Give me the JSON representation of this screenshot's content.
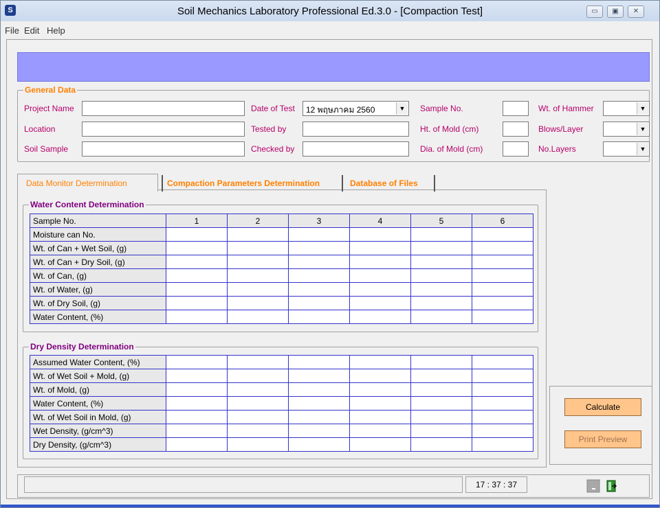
{
  "window": {
    "title": "Soil Mechanics Laboratory Professional Ed.3.0 -  [Compaction Test]",
    "app_icon_glyph": "S",
    "controls": {
      "minimize": "▭",
      "maximize": "▣",
      "close": "✕"
    }
  },
  "menu": [
    "File",
    "Edit",
    "Help"
  ],
  "colors": {
    "banner": "#9999ff",
    "label": "#b5006a",
    "legend_orange": "#ff8000",
    "legend_purple": "#800080",
    "grid_border": "#3333cc",
    "button": "#ffc58a"
  },
  "general_data": {
    "legend": "General Data",
    "project_name": {
      "label": "Project Name",
      "value": ""
    },
    "location": {
      "label": "Location",
      "value": ""
    },
    "soil_sample": {
      "label": "Soil Sample",
      "value": ""
    },
    "date_of_test": {
      "label": "Date of Test",
      "value": "12  พฤษภาคม  2560"
    },
    "tested_by": {
      "label": "Tested by",
      "value": ""
    },
    "checked_by": {
      "label": "Checked by",
      "value": ""
    },
    "sample_no": {
      "label": "Sample No.",
      "value": ""
    },
    "ht_of_mold": {
      "label": "Ht. of Mold (cm)",
      "value": ""
    },
    "dia_of_mold": {
      "label": "Dia. of Mold (cm)",
      "value": ""
    },
    "wt_of_hammer": {
      "label": "Wt. of Hammer",
      "value": ""
    },
    "blows_layer": {
      "label": "Blows/Layer",
      "value": ""
    },
    "no_layers": {
      "label": "No.Layers",
      "value": ""
    }
  },
  "tabs": [
    {
      "label": "Data Monitor Determination",
      "active": true
    },
    {
      "label": "Compaction Parameters Determination",
      "active": false
    },
    {
      "label": "Database of Files",
      "active": false
    }
  ],
  "water_content": {
    "legend": "Water Content Determination",
    "header_label": "Sample No.",
    "columns": [
      "1",
      "2",
      "3",
      "4",
      "5",
      "6"
    ],
    "rows": [
      "Moisture can No.",
      "Wt. of Can + Wet Soil, (g)",
      "Wt. of Can + Dry Soil, (g)",
      "Wt. of Can, (g)",
      "Wt. of Water, (g)",
      "Wt. of Dry Soil, (g)",
      "Water Content, (%)"
    ]
  },
  "dry_density": {
    "legend": "Dry Density Determination",
    "rows": [
      "Assumed Water Content, (%)",
      "Wt. of Wet Soil + Mold, (g)",
      "Wt. of Mold, (g)",
      "Water Content, (%)",
      "Wt. of Wet Soil in Mold, (g)",
      "Wet Density, (g/cm^3)",
      "Dry  Density, (g/cm^3)"
    ]
  },
  "buttons": {
    "calculate": "Calculate",
    "print_preview": "Print Preview"
  },
  "status": {
    "message": "",
    "time": "17 : 37 : 37"
  },
  "icons": {
    "minimize_app": "minimize-icon",
    "exit": "exit-door-icon"
  }
}
